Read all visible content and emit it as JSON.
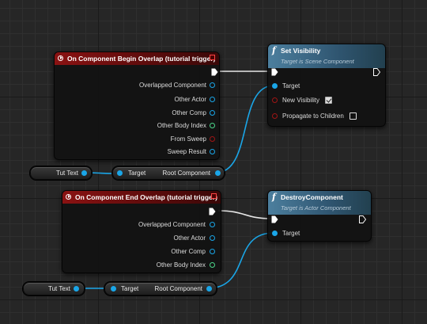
{
  "event_begin": {
    "title": "On Component Begin Overlap (tutorial trigger)",
    "pins": [
      "Overlapped Component",
      "Other Actor",
      "Other Comp",
      "Other Body Index",
      "From Sweep",
      "Sweep Result"
    ]
  },
  "set_visibility": {
    "title": "Set Visibility",
    "subtitle": "Target is Scene Component",
    "target_label": "Target",
    "new_visibility_label": "New Visibility",
    "new_visibility_checked": true,
    "propagate_label": "Propagate to Children",
    "propagate_checked": false
  },
  "var_top": {
    "label": "Tut Text"
  },
  "get_top": {
    "target_label": "Target",
    "output_label": "Root Component"
  },
  "event_end": {
    "title": "On Component End Overlap (tutorial trigger)",
    "pins": [
      "Overlapped Component",
      "Other Actor",
      "Other Comp",
      "Other Body Index"
    ]
  },
  "destroy": {
    "title": "DestroyComponent",
    "subtitle": "Target is Actor Component",
    "target_label": "Target"
  },
  "var_bottom": {
    "label": "Tut Text"
  },
  "get_bottom": {
    "target_label": "Target",
    "output_label": "Root Component"
  },
  "colors": {
    "object_pin": "#1aa6e8",
    "int_pin": "#4bd78a",
    "bool_pin": "#a01515",
    "event_header": "#8a1212",
    "function_header": "#4c7f9e"
  }
}
